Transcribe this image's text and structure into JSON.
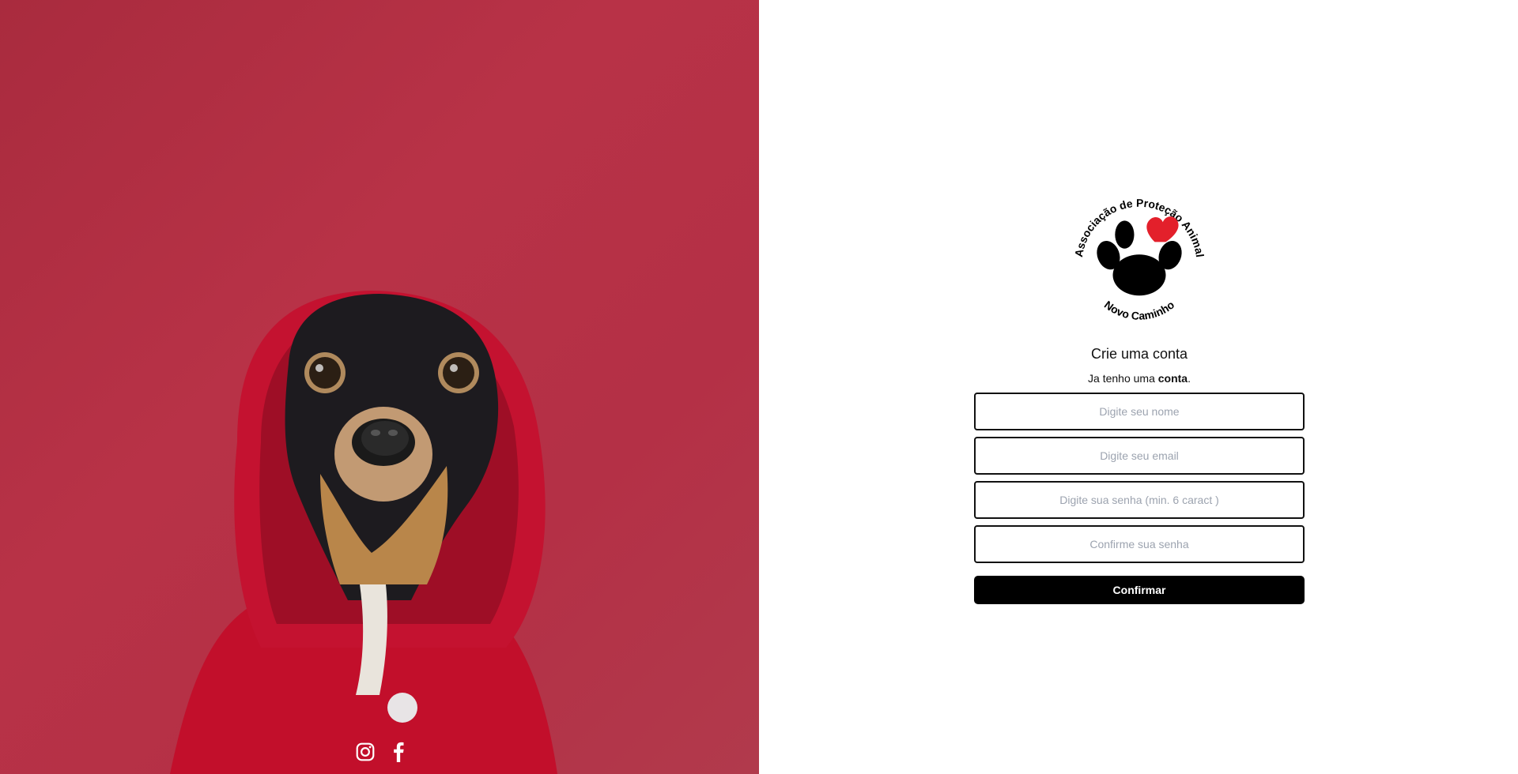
{
  "hero": {
    "social": [
      {
        "icon": "instagram-icon"
      },
      {
        "icon": "facebook-icon"
      }
    ]
  },
  "logo": {
    "top_text": "Associação de Proteção Animal",
    "bottom_text": "Novo Caminho",
    "heart_color": "#e3202b"
  },
  "form": {
    "title": "Crie uma conta",
    "have_account_prefix": "Ja tenho uma ",
    "have_account_link": "conta",
    "have_account_suffix": ".",
    "name_placeholder": "Digite seu nome",
    "email_placeholder": "Digite seu email",
    "password_placeholder": "Digite sua senha (min. 6 caract )",
    "confirm_password_placeholder": "Confirme sua senha",
    "submit_label": "Confirmar"
  },
  "colors": {
    "hero_background": "#b3324a",
    "hoodie": "#c8102e",
    "button": "#000000"
  }
}
